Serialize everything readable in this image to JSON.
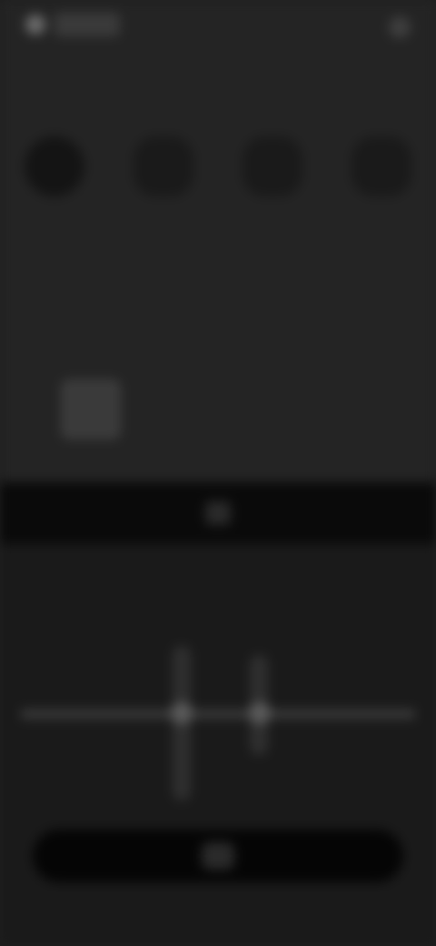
{
  "topbar": {
    "back_icon": "back-icon",
    "title": "",
    "action_label": ""
  },
  "tools": [
    {
      "icon": "tool-icon",
      "label": ""
    },
    {
      "icon": "tool-icon",
      "label": ""
    },
    {
      "icon": "tool-icon",
      "label": ""
    },
    {
      "icon": "tool-icon",
      "label": ""
    }
  ],
  "preview": {
    "label": ""
  },
  "sheet": {
    "title": "",
    "bottom_button_label": ""
  },
  "colors": {
    "background": "#242424",
    "sheet": "#1a1a1a",
    "header": "#0a0a0a"
  }
}
